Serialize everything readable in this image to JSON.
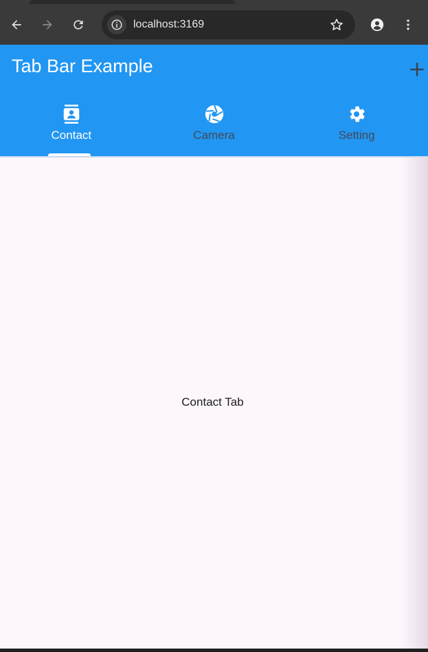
{
  "browser": {
    "url": "localhost:3169",
    "icons": {
      "back": "arrow-left-icon",
      "forward": "arrow-right-icon",
      "reload": "reload-icon",
      "info": "info-icon",
      "bookmark": "star-icon",
      "profile": "profile-icon",
      "menu": "kebab-menu-icon"
    }
  },
  "app": {
    "title": "Tab Bar Example",
    "action_icon": "plus-icon",
    "colors": {
      "appbar": "#2196f3",
      "active_tab": "#ffffff",
      "inactive_tab": "#444a55",
      "background": "#fdf7fd"
    },
    "tabs": [
      {
        "label": "Contact",
        "icon": "contact-icon",
        "active": true
      },
      {
        "label": "Camera",
        "icon": "camera-icon",
        "active": false
      },
      {
        "label": "Setting",
        "icon": "settings-icon",
        "active": false
      }
    ],
    "content": "Contact Tab"
  }
}
